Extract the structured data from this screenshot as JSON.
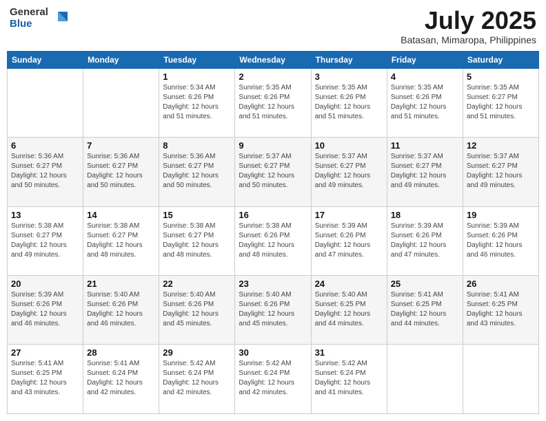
{
  "logo": {
    "general": "General",
    "blue": "Blue"
  },
  "header": {
    "title": "July 2025",
    "subtitle": "Batasan, Mimaropa, Philippines"
  },
  "days_of_week": [
    "Sunday",
    "Monday",
    "Tuesday",
    "Wednesday",
    "Thursday",
    "Friday",
    "Saturday"
  ],
  "weeks": [
    [
      {
        "day": "",
        "info": ""
      },
      {
        "day": "",
        "info": ""
      },
      {
        "day": "1",
        "info": "Sunrise: 5:34 AM\nSunset: 6:26 PM\nDaylight: 12 hours and 51 minutes."
      },
      {
        "day": "2",
        "info": "Sunrise: 5:35 AM\nSunset: 6:26 PM\nDaylight: 12 hours and 51 minutes."
      },
      {
        "day": "3",
        "info": "Sunrise: 5:35 AM\nSunset: 6:26 PM\nDaylight: 12 hours and 51 minutes."
      },
      {
        "day": "4",
        "info": "Sunrise: 5:35 AM\nSunset: 6:26 PM\nDaylight: 12 hours and 51 minutes."
      },
      {
        "day": "5",
        "info": "Sunrise: 5:35 AM\nSunset: 6:27 PM\nDaylight: 12 hours and 51 minutes."
      }
    ],
    [
      {
        "day": "6",
        "info": "Sunrise: 5:36 AM\nSunset: 6:27 PM\nDaylight: 12 hours and 50 minutes."
      },
      {
        "day": "7",
        "info": "Sunrise: 5:36 AM\nSunset: 6:27 PM\nDaylight: 12 hours and 50 minutes."
      },
      {
        "day": "8",
        "info": "Sunrise: 5:36 AM\nSunset: 6:27 PM\nDaylight: 12 hours and 50 minutes."
      },
      {
        "day": "9",
        "info": "Sunrise: 5:37 AM\nSunset: 6:27 PM\nDaylight: 12 hours and 50 minutes."
      },
      {
        "day": "10",
        "info": "Sunrise: 5:37 AM\nSunset: 6:27 PM\nDaylight: 12 hours and 49 minutes."
      },
      {
        "day": "11",
        "info": "Sunrise: 5:37 AM\nSunset: 6:27 PM\nDaylight: 12 hours and 49 minutes."
      },
      {
        "day": "12",
        "info": "Sunrise: 5:37 AM\nSunset: 6:27 PM\nDaylight: 12 hours and 49 minutes."
      }
    ],
    [
      {
        "day": "13",
        "info": "Sunrise: 5:38 AM\nSunset: 6:27 PM\nDaylight: 12 hours and 49 minutes."
      },
      {
        "day": "14",
        "info": "Sunrise: 5:38 AM\nSunset: 6:27 PM\nDaylight: 12 hours and 48 minutes."
      },
      {
        "day": "15",
        "info": "Sunrise: 5:38 AM\nSunset: 6:27 PM\nDaylight: 12 hours and 48 minutes."
      },
      {
        "day": "16",
        "info": "Sunrise: 5:38 AM\nSunset: 6:26 PM\nDaylight: 12 hours and 48 minutes."
      },
      {
        "day": "17",
        "info": "Sunrise: 5:39 AM\nSunset: 6:26 PM\nDaylight: 12 hours and 47 minutes."
      },
      {
        "day": "18",
        "info": "Sunrise: 5:39 AM\nSunset: 6:26 PM\nDaylight: 12 hours and 47 minutes."
      },
      {
        "day": "19",
        "info": "Sunrise: 5:39 AM\nSunset: 6:26 PM\nDaylight: 12 hours and 46 minutes."
      }
    ],
    [
      {
        "day": "20",
        "info": "Sunrise: 5:39 AM\nSunset: 6:26 PM\nDaylight: 12 hours and 46 minutes."
      },
      {
        "day": "21",
        "info": "Sunrise: 5:40 AM\nSunset: 6:26 PM\nDaylight: 12 hours and 46 minutes."
      },
      {
        "day": "22",
        "info": "Sunrise: 5:40 AM\nSunset: 6:26 PM\nDaylight: 12 hours and 45 minutes."
      },
      {
        "day": "23",
        "info": "Sunrise: 5:40 AM\nSunset: 6:26 PM\nDaylight: 12 hours and 45 minutes."
      },
      {
        "day": "24",
        "info": "Sunrise: 5:40 AM\nSunset: 6:25 PM\nDaylight: 12 hours and 44 minutes."
      },
      {
        "day": "25",
        "info": "Sunrise: 5:41 AM\nSunset: 6:25 PM\nDaylight: 12 hours and 44 minutes."
      },
      {
        "day": "26",
        "info": "Sunrise: 5:41 AM\nSunset: 6:25 PM\nDaylight: 12 hours and 43 minutes."
      }
    ],
    [
      {
        "day": "27",
        "info": "Sunrise: 5:41 AM\nSunset: 6:25 PM\nDaylight: 12 hours and 43 minutes."
      },
      {
        "day": "28",
        "info": "Sunrise: 5:41 AM\nSunset: 6:24 PM\nDaylight: 12 hours and 42 minutes."
      },
      {
        "day": "29",
        "info": "Sunrise: 5:42 AM\nSunset: 6:24 PM\nDaylight: 12 hours and 42 minutes."
      },
      {
        "day": "30",
        "info": "Sunrise: 5:42 AM\nSunset: 6:24 PM\nDaylight: 12 hours and 42 minutes."
      },
      {
        "day": "31",
        "info": "Sunrise: 5:42 AM\nSunset: 6:24 PM\nDaylight: 12 hours and 41 minutes."
      },
      {
        "day": "",
        "info": ""
      },
      {
        "day": "",
        "info": ""
      }
    ]
  ]
}
